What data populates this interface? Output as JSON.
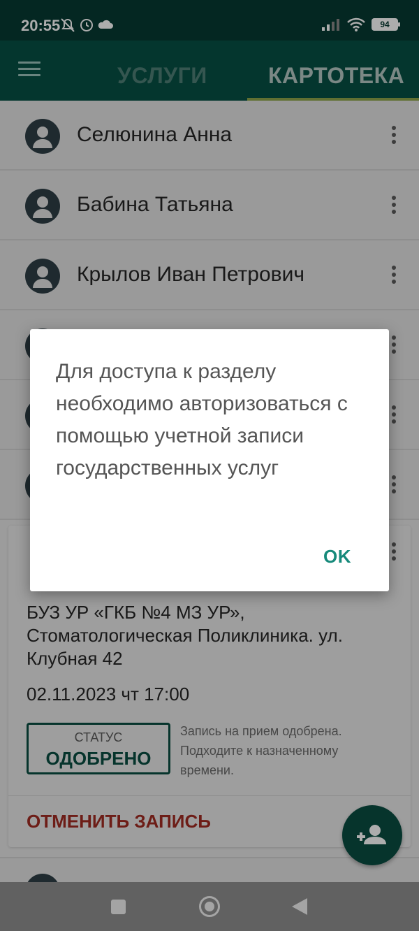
{
  "status_bar": {
    "time": "20:55",
    "battery": "94"
  },
  "app_bar": {
    "tabs": [
      {
        "label": "УСЛУГИ"
      },
      {
        "label": "КАРТОТЕКА"
      }
    ]
  },
  "people": [
    {
      "name": "Селюнина Анна"
    },
    {
      "name": "Бабина Татьяна"
    },
    {
      "name": "Крылов Иван Петрович"
    }
  ],
  "appointment": {
    "clinic": "БУЗ УР «ГКБ №4 МЗ УР», Стоматологическая Поликлиника. ул. Клубная 42",
    "datetime": "02.11.2023 чт 17:00",
    "status_label": "СТАТУС",
    "status_value": "ОДОБРЕНО",
    "status_note": "Запись на прием одобрена. Подходите к назначенному времени.",
    "cancel_label": "ОТМЕНИТЬ ЗАПИСЬ"
  },
  "dialog": {
    "message": "Для доступа к разделу необходимо авторизоваться с помощью учетной записи государственных услуг",
    "ok_label": "OK"
  },
  "colors": {
    "primary": "#075045",
    "accent": "#178a7b",
    "danger": "#a12b22"
  }
}
